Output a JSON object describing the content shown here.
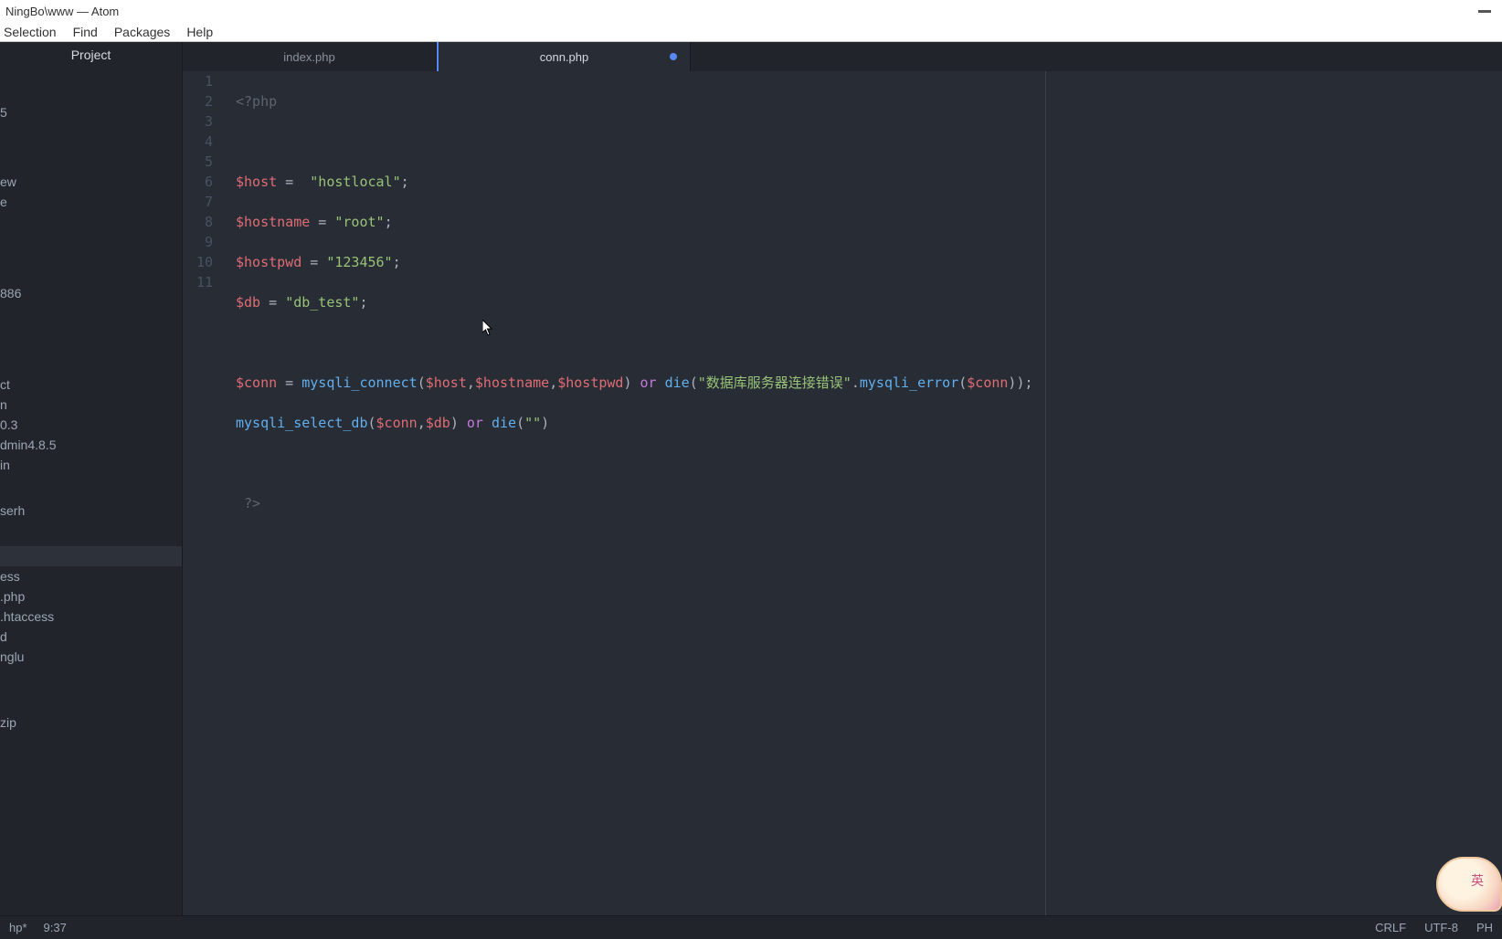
{
  "window": {
    "title": "NingBo\\www — Atom"
  },
  "menu": {
    "items": [
      "Selection",
      "Find",
      "Packages",
      "Help"
    ]
  },
  "sidebar": {
    "header": "Project",
    "items": [
      {
        "label": "5",
        "type": "folder"
      },
      {
        "label": "",
        "type": "spacer"
      },
      {
        "label": "ew",
        "type": "folder"
      },
      {
        "label": "e",
        "type": "folder"
      },
      {
        "label": "",
        "type": "spacer"
      },
      {
        "label": "886",
        "type": "folder"
      },
      {
        "label": "",
        "type": "spacer"
      },
      {
        "label": "",
        "type": "spacer"
      },
      {
        "label": "ct",
        "type": "folder"
      },
      {
        "label": "n",
        "type": "folder"
      },
      {
        "label": "0.3",
        "type": "folder"
      },
      {
        "label": "dmin4.8.5",
        "type": "folder"
      },
      {
        "label": "in",
        "type": "folder"
      },
      {
        "label": "",
        "type": "spacer"
      },
      {
        "label": "serh",
        "type": "folder"
      },
      {
        "label": "",
        "type": "spacer"
      },
      {
        "label": "",
        "type": "selected"
      },
      {
        "label": "ess",
        "type": "file"
      },
      {
        "label": ".php",
        "type": "file"
      },
      {
        "label": ".htaccess",
        "type": "file"
      },
      {
        "label": "d",
        "type": "file"
      },
      {
        "label": "nglu",
        "type": "file"
      },
      {
        "label": "",
        "type": "file"
      },
      {
        "label": "",
        "type": "spacer"
      },
      {
        "label": "zip",
        "type": "file"
      }
    ]
  },
  "tabs": [
    {
      "label": "index.php",
      "active": false,
      "modified": false
    },
    {
      "label": "conn.php",
      "active": true,
      "modified": true
    }
  ],
  "editor": {
    "line_count": 11,
    "lines": {
      "l1": {
        "open": "<?php"
      },
      "l2": {
        "text": ""
      },
      "l3": {
        "var": "$host",
        "op": " =  ",
        "str": "\"hostlocal\"",
        "end": ";"
      },
      "l4": {
        "var": "$hostname",
        "op": " = ",
        "str": "\"root\"",
        "end": ";"
      },
      "l5": {
        "var": "$hostpwd",
        "op": " = ",
        "str": "\"123456\"",
        "end": ";"
      },
      "l6": {
        "var": "$db",
        "op": " = ",
        "str": "\"db_test\"",
        "end": ";"
      },
      "l7": {
        "text": ""
      },
      "l8": {
        "v1": "$conn",
        "op1": " = ",
        "f1": "mysqli_connect",
        "p1": "(",
        "a1": "$host",
        "c1": ",",
        "a2": "$hostname",
        "c2": ",",
        "a3": "$hostpwd",
        "p2": ") ",
        "kw1": "or",
        "sp1": " ",
        "f2": "die",
        "p3": "(",
        "s1": "\"数据库服务器连接错误\"",
        "dot": ".",
        "f3": "mysqli_error",
        "p4": "(",
        "a4": "$conn",
        "p5": "))",
        "end": ";"
      },
      "l9": {
        "f1": "mysqli_select_db",
        "p1": "(",
        "a1": "$conn",
        "c1": ",",
        "a2": "$db",
        "p2": ") ",
        "kw1": "or",
        "sp1": " ",
        "f2": "die",
        "p3": "(",
        "s1": "\"\"",
        "p4": ")"
      },
      "l10": {
        "text": ""
      },
      "l11": {
        "close": " ?>"
      }
    }
  },
  "status": {
    "file": "hp*",
    "cursor": "9:37",
    "eol": "CRLF",
    "encoding": "UTF-8",
    "lang": "PH"
  }
}
